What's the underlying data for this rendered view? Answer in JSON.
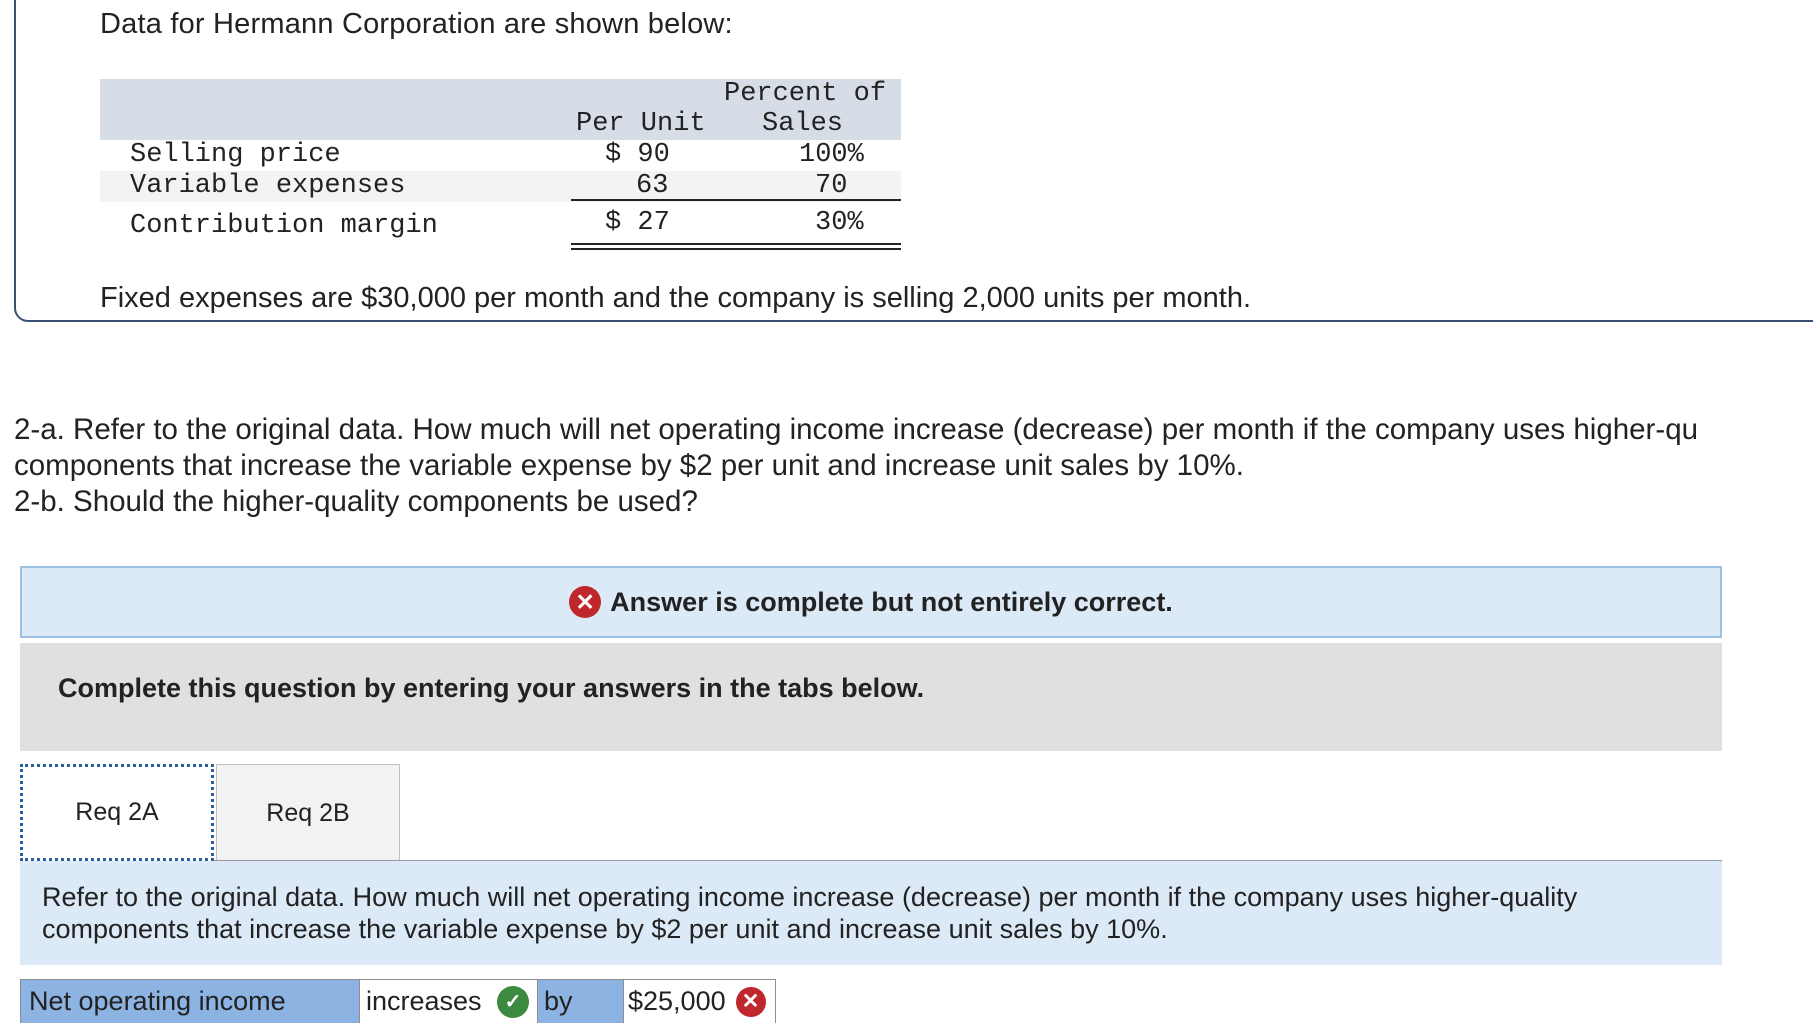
{
  "intro": "Data for Hermann Corporation are shown below:",
  "table": {
    "col_per_unit": "Per Unit",
    "col_percent_l1": "Percent of",
    "col_percent_l2": "Sales",
    "rows": [
      {
        "label": "Selling price",
        "unit": "$ 90",
        "pct": "100%"
      },
      {
        "label": "Variable expenses",
        "unit": "63",
        "pct": "70"
      },
      {
        "label": "Contribution margin",
        "unit": "$ 27",
        "pct": "30%"
      }
    ]
  },
  "fixed_text": "Fixed expenses are $30,000 per month and the company is selling 2,000 units per month.",
  "question": {
    "line1": "2-a. Refer to the original data. How much will net operating income increase (decrease) per month if the company uses higher-qu",
    "line2": "components that increase the variable expense by $2 per unit and increase unit sales by 10%.",
    "line3": "2-b. Should the higher-quality components be used?"
  },
  "alert": "Answer is complete but not entirely correct.",
  "instruction": "Complete this question by entering your answers in the tabs below.",
  "tabs": [
    {
      "label": "Req 2A"
    },
    {
      "label": "Req 2B"
    }
  ],
  "tab_question": "Refer to the original data. How much will net operating income increase (decrease) per month if the company uses higher-quality components that increase the variable expense by $2 per unit and increase unit sales by 10%.",
  "answer": {
    "label": "Net operating income",
    "select_value": "increases",
    "by_label": "by",
    "amount": "$25,000"
  },
  "icons": {
    "check": "check-icon",
    "error": "x-circle-icon"
  },
  "colors": {
    "error": "#c0272d",
    "correct": "#3c8a3f",
    "header_blue": "#8db3e2",
    "info_bg": "#dceaf7"
  }
}
